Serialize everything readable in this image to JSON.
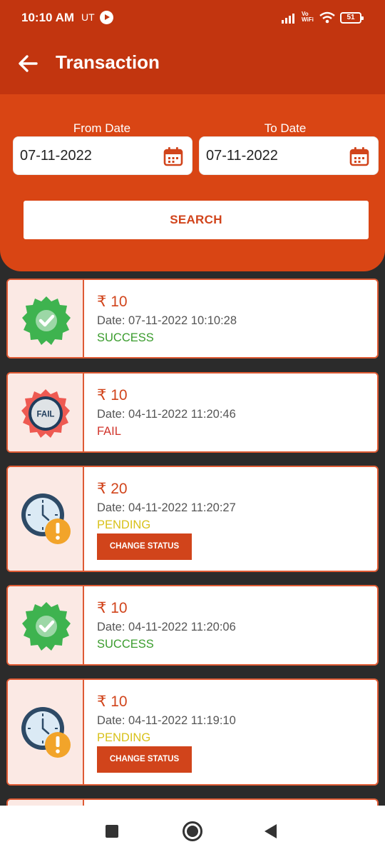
{
  "status_bar": {
    "time": "10:10 AM",
    "carrier": "UT",
    "vowifi_top": "Vo",
    "vowifi_bottom": "WiFi",
    "battery": "51"
  },
  "header": {
    "title": "Transaction"
  },
  "filter": {
    "from_label": "From Date",
    "from_value": "07-11-2022",
    "to_label": "To Date",
    "to_value": "07-11-2022",
    "search_label": "SEARCH"
  },
  "colors": {
    "primary": "#d94514",
    "appbar": "#c2350f",
    "success": "#3a9c2d",
    "fail": "#d1342b",
    "pending": "#d8c11a"
  },
  "transactions": [
    {
      "amount": "₹ 10",
      "date": "Date: 07-11-2022 10:10:28",
      "status": "SUCCESS",
      "icon": "success-badge-icon"
    },
    {
      "amount": "₹ 10",
      "date": "Date: 04-11-2022 11:20:46",
      "status": "FAIL",
      "icon": "fail-badge-icon",
      "icon_text": "FAIL"
    },
    {
      "amount": "₹ 20",
      "date": "Date: 04-11-2022 11:20:27",
      "status": "PENDING",
      "icon": "pending-clock-icon",
      "action": "CHANGE STATUS"
    },
    {
      "amount": "₹ 10",
      "date": "Date: 04-11-2022 11:20:06",
      "status": "SUCCESS",
      "icon": "success-badge-icon"
    },
    {
      "amount": "₹ 10",
      "date": "Date: 04-11-2022 11:19:10",
      "status": "PENDING",
      "icon": "pending-clock-icon",
      "action": "CHANGE STATUS"
    }
  ]
}
